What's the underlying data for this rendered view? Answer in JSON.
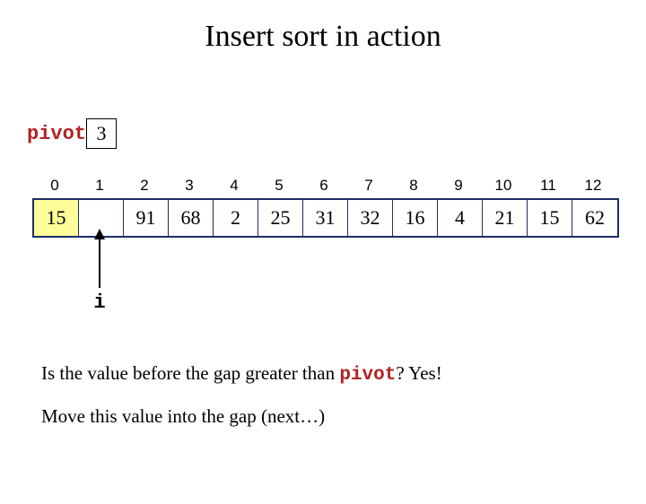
{
  "title": "Insert sort in action",
  "pivot": {
    "label": "pivot",
    "value": "3"
  },
  "indices": [
    "0",
    "1",
    "2",
    "3",
    "4",
    "5",
    "6",
    "7",
    "8",
    "9",
    "10",
    "11",
    "12"
  ],
  "cells": [
    {
      "val": "15",
      "cls": "sorted"
    },
    {
      "val": "",
      "cls": "gap"
    },
    {
      "val": "91",
      "cls": ""
    },
    {
      "val": "68",
      "cls": ""
    },
    {
      "val": "2",
      "cls": ""
    },
    {
      "val": "25",
      "cls": ""
    },
    {
      "val": "31",
      "cls": ""
    },
    {
      "val": "32",
      "cls": ""
    },
    {
      "val": "16",
      "cls": ""
    },
    {
      "val": "4",
      "cls": ""
    },
    {
      "val": "21",
      "cls": ""
    },
    {
      "val": "15",
      "cls": ""
    },
    {
      "val": "62",
      "cls": ""
    }
  ],
  "pointer": {
    "label": "i",
    "index": 1
  },
  "text": {
    "q_prefix": "Is the value before the gap greater than ",
    "q_keyword": "pivot",
    "q_suffix": "? Yes!",
    "line2": "Move this value into the gap (next…)"
  }
}
